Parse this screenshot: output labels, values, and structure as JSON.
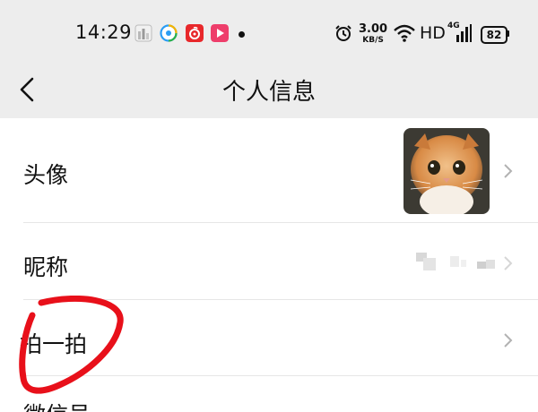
{
  "status_bar": {
    "time": "14:29",
    "net_speed_value": "3.00",
    "net_speed_unit": "KB/S",
    "hd": "HD",
    "signal": "4G",
    "battery": "82",
    "icons": [
      "gallery-app-icon",
      "browser-app-icon",
      "music-app-icon",
      "video-app-icon",
      "alarm-icon",
      "wifi-icon",
      "signal-icon",
      "battery-icon"
    ]
  },
  "header": {
    "title": "个人信息",
    "back_icon": "chevron-left-icon"
  },
  "rows": [
    {
      "label": "头像"
    },
    {
      "label": "昵称"
    },
    {
      "label": "拍一拍"
    },
    {
      "label": "微信号"
    }
  ],
  "colors": {
    "header_bg": "#ededed",
    "annotation_red": "#e8101a",
    "chevron": "#b2b2b2"
  }
}
